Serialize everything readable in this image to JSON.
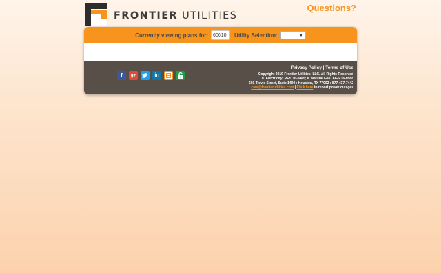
{
  "header": {
    "logo_word1": "FRONTIER",
    "logo_word2": "UTILITIES",
    "questions_link": "Questions?"
  },
  "plan_bar": {
    "viewing_label": "Currently viewing plans for:",
    "zip_value": "60610",
    "utility_label": "Utility Selection:",
    "utility_selected": ""
  },
  "footer": {
    "social_icons": [
      "facebook-icon",
      "google-plus-icon",
      "twitter-icon",
      "linkedin-icon",
      "blog-icon",
      "lock-icon"
    ],
    "privacy_link": "Privacy Policy",
    "separator": "|",
    "terms_link": "Terms of Use",
    "copyright": "Copyright 2019 Frontier Utilities, LLC. All Rights Reserved",
    "license": "IL Electricity: RES 16-0485; IL Natural Gas: AGS 16-0588",
    "address": "601 Travis Street, Suite 1400 : Houston, TX 77002 : 877-437-7442",
    "email": "care@frontierutilities.com",
    "email_sep": " | ",
    "click_here": "Click here",
    "outage_text": " to report power outages"
  },
  "colors": {
    "brand_orange": "#f7941d",
    "footer_bg": "#585048",
    "logo_dark": "#2d2d2d"
  }
}
